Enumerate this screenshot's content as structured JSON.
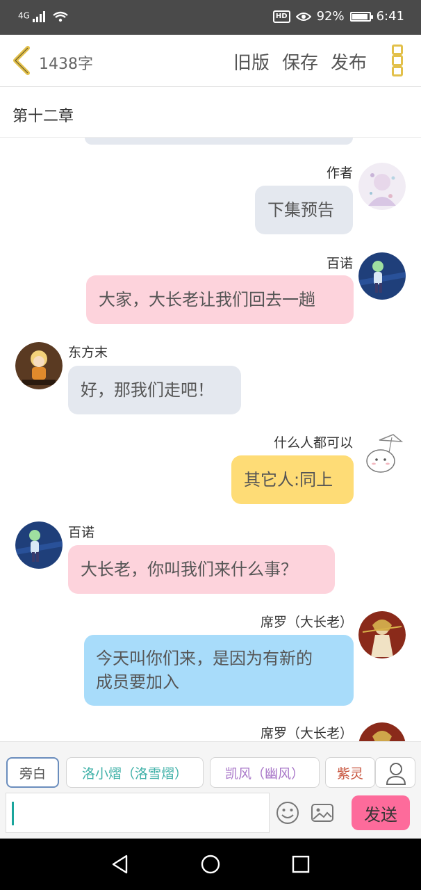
{
  "status_bar": {
    "network": "4G",
    "battery": "92%",
    "time": "6:41",
    "hd": "HD",
    "battery_level": 0.92
  },
  "header": {
    "word_count": "1438字",
    "actions": [
      "旧版",
      "保存",
      "发布"
    ]
  },
  "chapter": {
    "title": "第十二章"
  },
  "messages": [
    {
      "side": "right",
      "name": "作者",
      "text": "下集预告",
      "bubble_color": "#e4e8ef",
      "avatar": "author-avatar"
    },
    {
      "side": "right",
      "name": "百诺",
      "text": "大家，大长老让我们回去一趟",
      "bubble_color": "#fdd3dc",
      "avatar": "bainuo-avatar"
    },
    {
      "side": "left",
      "name": "东方末",
      "text": "好，那我们走吧！",
      "bubble_color": "#e4e8ef",
      "avatar": "dongfangmo-avatar"
    },
    {
      "side": "right",
      "name": "什么人都可以",
      "text": "其它人:同上",
      "bubble_color": "#fedc76",
      "avatar": "anyone-avatar"
    },
    {
      "side": "left",
      "name": "百诺",
      "text": "大长老，你叫我们来什么事？",
      "bubble_color": "#fdd3dc",
      "avatar": "bainuo-avatar"
    },
    {
      "side": "right",
      "name": "席罗（大长老）",
      "text_lines": [
        "今天叫你们来，是因为有新的",
        "成员要加入"
      ],
      "bubble_color": "#a8dcfa",
      "avatar": "xiluo-avatar"
    },
    {
      "side": "right",
      "name": "席罗（大长老）",
      "avatar": "xiluo-avatar"
    }
  ],
  "roles": [
    {
      "label": "旁白",
      "color": "#555555"
    },
    {
      "label": "洛小熠（洛雪熠）",
      "color": "#3fb1a8"
    },
    {
      "label": "凯风（幽风）",
      "color": "#a876c8"
    },
    {
      "label": "紫灵",
      "color": "#c8553e"
    }
  ],
  "composer": {
    "send_label": "发送",
    "input_value": ""
  },
  "colors": {
    "accent_gold": "#e2c04a",
    "send_pink": "#fd6b9b",
    "caret_teal": "#1aa59c"
  }
}
